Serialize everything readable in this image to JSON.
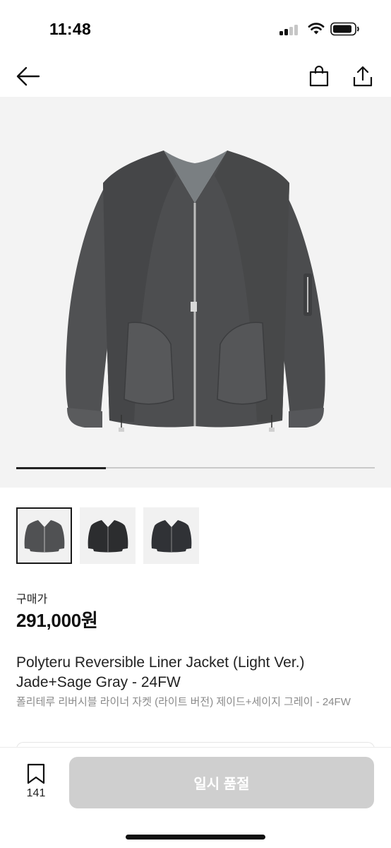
{
  "status_bar": {
    "time": "11:48",
    "signal_icon": "cellular-signal-icon",
    "wifi_icon": "wifi-icon",
    "battery_icon": "battery-icon"
  },
  "nav": {
    "back_icon": "back-arrow-icon",
    "bag_icon": "shopping-bag-icon",
    "share_icon": "share-icon"
  },
  "gallery": {
    "progress": 0.25,
    "thumbnail_count": 3,
    "active_thumbnail": 0
  },
  "price": {
    "label": "구매가",
    "value": "291,000원"
  },
  "product": {
    "name_en": "Polyteru Reversible Liner Jacket (Light Ver.) Jade+Sage Gray - 24FW",
    "name_ko": "폴리테루 리버시블 라이너 자켓 (라이트 버전) 제이드+세이지 그레이 - 24FW"
  },
  "bottom": {
    "wish_icon": "bookmark-icon",
    "wish_count": "141",
    "action_label": "일시 품절"
  },
  "colors": {
    "hero_bg": "#f3f3f3",
    "button_disabled": "#cfcfcf",
    "jacket": "#4a4b4d"
  }
}
